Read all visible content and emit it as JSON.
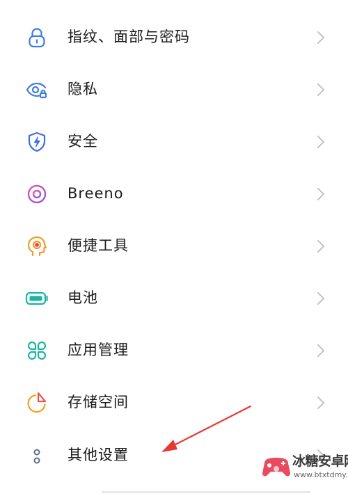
{
  "settings": {
    "items": [
      {
        "label": "指纹、面部与密码",
        "icon": "lock-icon",
        "color": "#3f7de0"
      },
      {
        "label": "隐私",
        "icon": "privacy-eye-icon",
        "color": "#3f7de0"
      },
      {
        "label": "安全",
        "icon": "shield-bolt-icon",
        "color": "#3f6fd6"
      },
      {
        "label": "Breeno",
        "icon": "breeno-ring-icon",
        "color": "#c04ed6"
      },
      {
        "label": "便捷工具",
        "icon": "head-target-icon",
        "color": "#f29b2c"
      },
      {
        "label": "电池",
        "icon": "battery-icon",
        "color": "#1bb5a2"
      },
      {
        "label": "应用管理",
        "icon": "app-grid-icon",
        "color": "#1bb5a2"
      },
      {
        "label": "存储空间",
        "icon": "pie-chart-icon",
        "color": "#f2a21c"
      },
      {
        "label": "其他设置",
        "icon": "dots-icon",
        "color": "#5c6e86"
      }
    ]
  },
  "watermark": {
    "title": "冰糖安卓网",
    "url": "www.btxtdmy.com"
  },
  "annotation": {
    "color": "#e53935"
  }
}
